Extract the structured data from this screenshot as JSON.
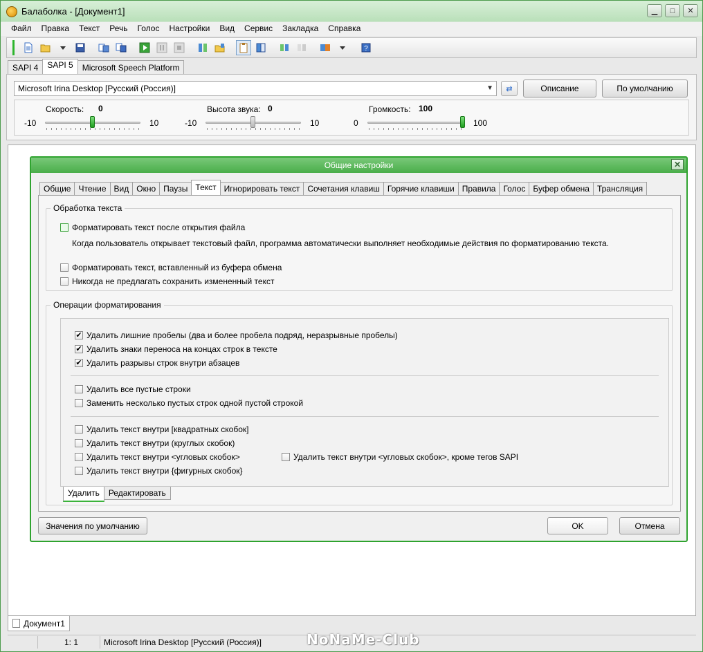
{
  "window": {
    "title": "Балаболка - [Документ1]"
  },
  "menu": [
    "Файл",
    "Правка",
    "Текст",
    "Речь",
    "Голос",
    "Настройки",
    "Вид",
    "Сервис",
    "Закладка",
    "Справка"
  ],
  "sapi_tabs": [
    "SAPI 4",
    "SAPI 5",
    "Microsoft Speech Platform"
  ],
  "voice": {
    "selected": "Microsoft Irina Desktop [Русский (Россия)]",
    "description_button": "Описание",
    "default_button": "По умолчанию"
  },
  "sliders": {
    "speed": {
      "label": "Скорость:",
      "value": "0",
      "min": "-10",
      "max": "10",
      "level": 0.5
    },
    "pitch": {
      "label": "Высота звука:",
      "value": "0",
      "min": "-10",
      "max": "10",
      "level": 0.5
    },
    "volume": {
      "label": "Громкость:",
      "value": "100",
      "min": "0",
      "max": "100",
      "level": 1.0
    }
  },
  "dialog": {
    "title": "Общие настройки",
    "tabs": [
      "Общие",
      "Чтение",
      "Вид",
      "Окно",
      "Паузы",
      "Текст",
      "Игнорировать текст",
      "Сочетания клавиш",
      "Горячие клавиши",
      "Правила",
      "Голос",
      "Буфер обмена",
      "Трансляция"
    ],
    "active_tab": "Текст",
    "text_processing": {
      "title": "Обработка текста",
      "format_after_open": "Форматировать текст после открытия файла",
      "format_hint": "Когда пользователь открывает текстовый файл, программа автоматически выполняет необходимые действия по форматированию текста.",
      "format_clipboard": "Форматировать текст, вставленный из буфера обмена",
      "never_save_prompt": "Никогда не предлагать сохранить измененный текст"
    },
    "formatting_ops": {
      "title": "Операции форматирования",
      "remove_spaces": "Удалить лишние пробелы (два и более пробела подряд, неразрывные пробелы)",
      "remove_hyphens": "Удалить знаки переноса на концах строк в тексте",
      "remove_breaks": "Удалить разрывы строк внутри абзацев",
      "remove_empty": "Удалить все пустые строки",
      "replace_empty": "Заменить несколько пустых строк одной пустой строкой",
      "remove_square": "Удалить текст внутри [квадратных скобок]",
      "remove_round": "Удалить текст внутри (круглых скобок)",
      "remove_angle": "Удалить текст внутри <угловых скобок>",
      "remove_angle_except_sapi": "Удалить текст внутри <угловых скобок>, кроме тегов SAPI",
      "remove_curly": "Удалить текст внутри {фигурных скобок}",
      "sub_tabs": [
        "Удалить",
        "Редактировать"
      ]
    },
    "buttons": {
      "defaults": "Значения по умолчанию",
      "ok": "OK",
      "cancel": "Отмена"
    }
  },
  "document_tab": "Документ1",
  "status": {
    "position": "1:   1",
    "voice": "Microsoft Irina Desktop [Русский (Россия)]"
  },
  "watermark": "NoNaMe-Club"
}
